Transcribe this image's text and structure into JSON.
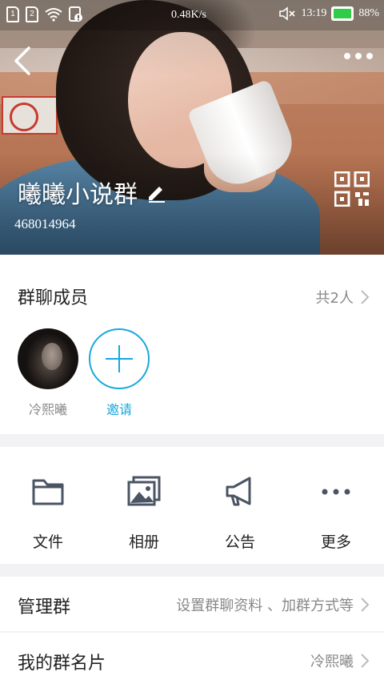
{
  "status_bar": {
    "sim1": "1",
    "sim2": "2",
    "speed": "0.48K/s",
    "time": "13:19",
    "battery": "88%",
    "battery_color": "#2ecc47"
  },
  "header": {
    "group_name": "曦曦小说群",
    "group_id": "468014964"
  },
  "members": {
    "title": "群聊成员",
    "count_text": "共2人",
    "items": [
      {
        "name": "冷熙曦"
      },
      {
        "name": "邀请"
      }
    ]
  },
  "actions": [
    {
      "label": "文件",
      "icon": "folder-icon"
    },
    {
      "label": "相册",
      "icon": "album-icon"
    },
    {
      "label": "公告",
      "icon": "megaphone-icon"
    },
    {
      "label": "更多",
      "icon": "more-dots-icon"
    }
  ],
  "manage": {
    "title": "管理群",
    "hint": "设置群聊资料 、加群方式等"
  },
  "group_card": {
    "title": "我的群名片",
    "value": "冷熙曦"
  },
  "colors": {
    "accent": "#18a7dd",
    "text": "#222222",
    "muted": "#888888"
  }
}
